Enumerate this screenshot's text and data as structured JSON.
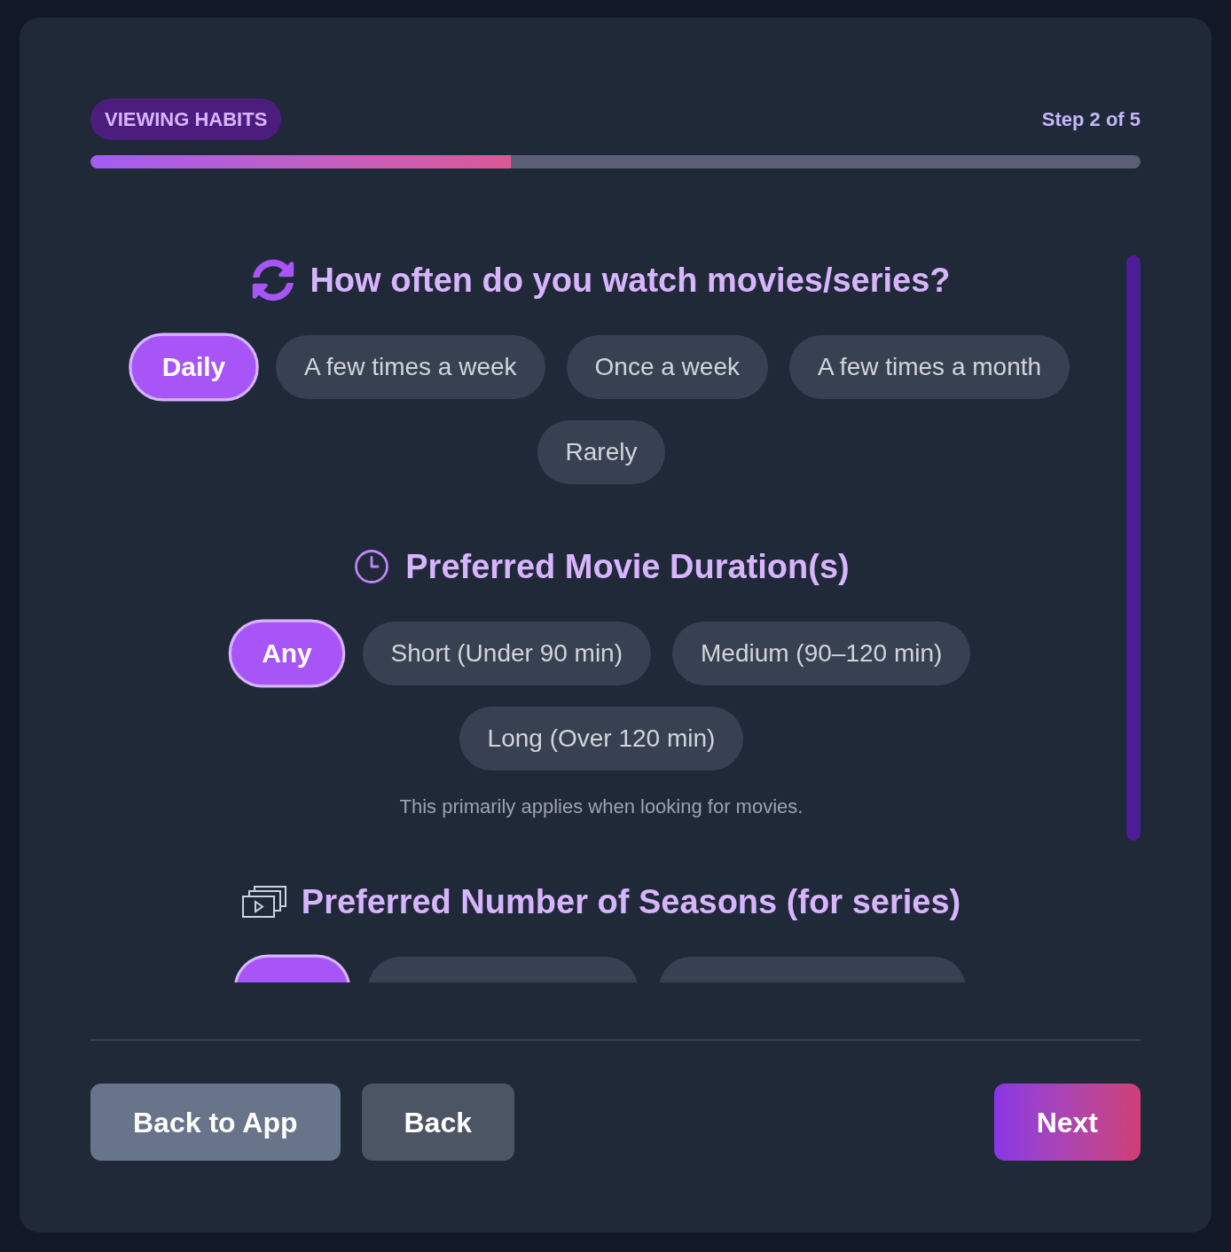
{
  "header": {
    "badge": "VIEWING HABITS",
    "step": "Step 2 of 5",
    "progress": {
      "level": 0.4
    }
  },
  "sections": [
    {
      "title": "How often do you watch movies/series?",
      "options": [
        {
          "label": "Daily",
          "selected": true
        },
        {
          "label": "A few times a week",
          "selected": false
        },
        {
          "label": "Once a week",
          "selected": false
        },
        {
          "label": "A few times a month",
          "selected": false
        },
        {
          "label": "Rarely",
          "selected": false
        }
      ]
    },
    {
      "title": "Preferred Movie Duration(s)",
      "options": [
        {
          "label": "Any",
          "selected": true
        },
        {
          "label": "Short (Under 90 min)",
          "selected": false
        },
        {
          "label": "Medium (90–120 min)",
          "selected": false
        },
        {
          "label": "Long (Over 120 min)",
          "selected": false
        }
      ],
      "note": "This primarily applies when looking for movies."
    },
    {
      "title": "Preferred Number of Seasons (for series)",
      "options": [
        {
          "selected": true
        },
        {
          "selected": false
        },
        {
          "selected": false
        }
      ]
    }
  ],
  "buttons": [
    {
      "label": "Back to App",
      "kind": "secondary"
    },
    {
      "label": "Back",
      "kind": "tertiary"
    },
    {
      "label": "Next",
      "kind": "primary"
    }
  ]
}
